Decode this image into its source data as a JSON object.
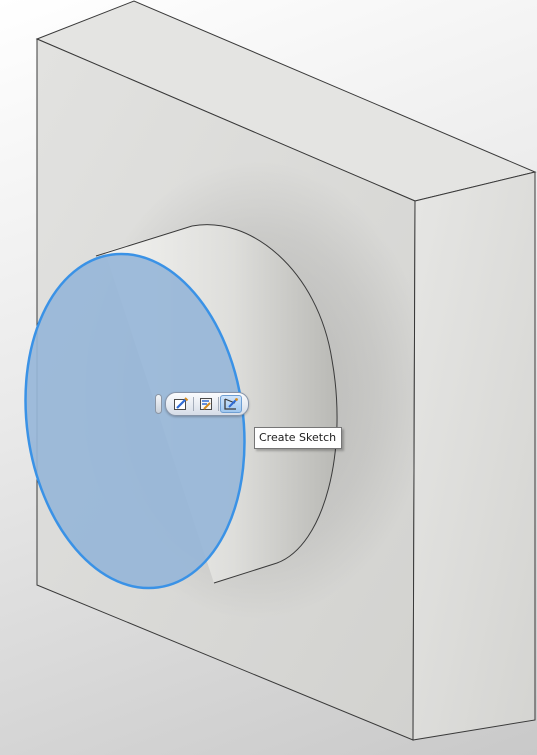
{
  "viewport": {
    "background": "#e6e6e6"
  },
  "model": {
    "block_color": "#dcdcd8",
    "edge_color": "#3a3a3a",
    "selected_face_fill": "#97b6d8",
    "selected_edge_color": "#3a92e6"
  },
  "mini_toolbar": {
    "buttons": [
      {
        "icon": "edit-sketch-icon"
      },
      {
        "icon": "edit-feature-icon"
      },
      {
        "icon": "create-sketch-icon",
        "active": true
      }
    ]
  },
  "tooltip": {
    "text": "Create Sketch"
  }
}
